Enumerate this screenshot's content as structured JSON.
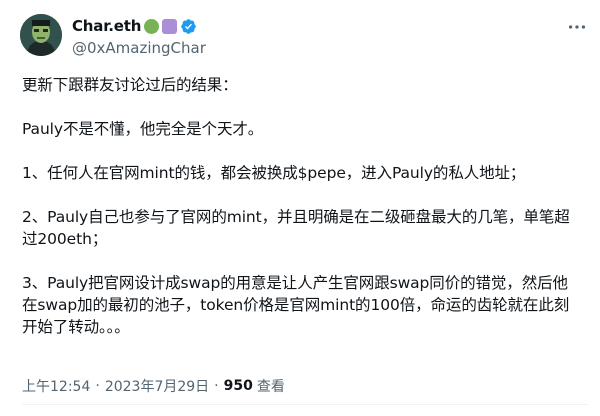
{
  "author": {
    "display_name": "Char.eth",
    "handle": "@0xAmazingChar",
    "avatar_icon": "zombie-avatar-icon"
  },
  "tweet": {
    "paragraphs": [
      "更新下跟群友讨论过后的结果：",
      "Pauly不是不懂，他完全是个天才。",
      "1、任何人在官网mint的钱，都会被换成$pepe，进入Pauly的私人地址；",
      "2、Pauly自己也参与了官网的mint，并且明确是在二级砸盘最大的几笔，单笔超过200eth；",
      "3、Pauly把官网设计成swap的用意是让人产生官网跟swap同价的错觉，然后他在swap加的最初的池子，token价格是官网mint的100倍，命运的齿轮就在此刻开始了转动。。。"
    ]
  },
  "meta": {
    "time": "上午12:54",
    "date": "2023年7月29日",
    "separator": "·",
    "views_count": "950",
    "views_label": "查看"
  },
  "colors": {
    "verified": "#1d9bf0",
    "muted_text": "#536471",
    "emoji_green": "#77b255",
    "emoji_purple": "#aa8ed6"
  }
}
